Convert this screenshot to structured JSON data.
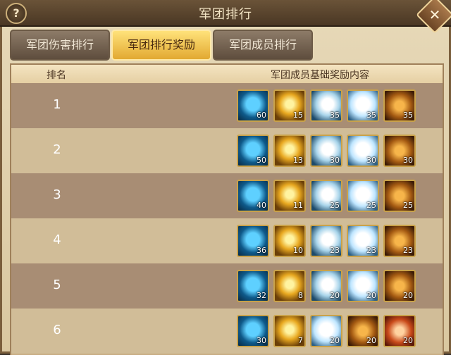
{
  "window": {
    "title": "军团排行",
    "help_label": "?",
    "close_label": "✕"
  },
  "tabs": [
    {
      "label": "军团伤害排行",
      "active": false
    },
    {
      "label": "军团排行奖励",
      "active": true
    },
    {
      "label": "军团成员排行",
      "active": false
    }
  ],
  "table": {
    "headers": {
      "rank": "排名",
      "rewards": "军团成员基础奖励内容"
    },
    "rows": [
      {
        "rank": "1",
        "items": [
          {
            "icon": "potion-icon",
            "count": "60"
          },
          {
            "icon": "gold-ore-icon",
            "count": "15"
          },
          {
            "icon": "feather-icon",
            "count": "35"
          },
          {
            "icon": "wing-icon",
            "count": "35"
          },
          {
            "icon": "grain-icon",
            "count": "35"
          }
        ]
      },
      {
        "rank": "2",
        "items": [
          {
            "icon": "potion-icon",
            "count": "50"
          },
          {
            "icon": "gold-ore-icon",
            "count": "13"
          },
          {
            "icon": "feather-icon",
            "count": "30"
          },
          {
            "icon": "wing-icon",
            "count": "30"
          },
          {
            "icon": "grain-icon",
            "count": "30"
          }
        ]
      },
      {
        "rank": "3",
        "items": [
          {
            "icon": "potion-icon",
            "count": "40"
          },
          {
            "icon": "gold-ore-icon",
            "count": "11"
          },
          {
            "icon": "feather-icon",
            "count": "25"
          },
          {
            "icon": "wing-icon",
            "count": "25"
          },
          {
            "icon": "grain-icon",
            "count": "25"
          }
        ]
      },
      {
        "rank": "4",
        "items": [
          {
            "icon": "potion-icon",
            "count": "36"
          },
          {
            "icon": "gold-ore-icon",
            "count": "10"
          },
          {
            "icon": "feather-icon",
            "count": "23"
          },
          {
            "icon": "wing-icon",
            "count": "23"
          },
          {
            "icon": "grain-icon",
            "count": "23"
          }
        ]
      },
      {
        "rank": "5",
        "items": [
          {
            "icon": "potion-icon",
            "count": "32"
          },
          {
            "icon": "gold-ore-icon",
            "count": "8"
          },
          {
            "icon": "feather-icon",
            "count": "20"
          },
          {
            "icon": "wing-icon",
            "count": "20"
          },
          {
            "icon": "grain-icon",
            "count": "20"
          }
        ]
      },
      {
        "rank": "6",
        "items": [
          {
            "icon": "potion-icon",
            "count": "30"
          },
          {
            "icon": "gold-ore-icon",
            "count": "7"
          },
          {
            "icon": "wing-icon",
            "count": "20"
          },
          {
            "icon": "grain-icon",
            "count": "20"
          },
          {
            "icon": "dragon-scale-icon",
            "count": "20"
          }
        ]
      }
    ]
  }
}
